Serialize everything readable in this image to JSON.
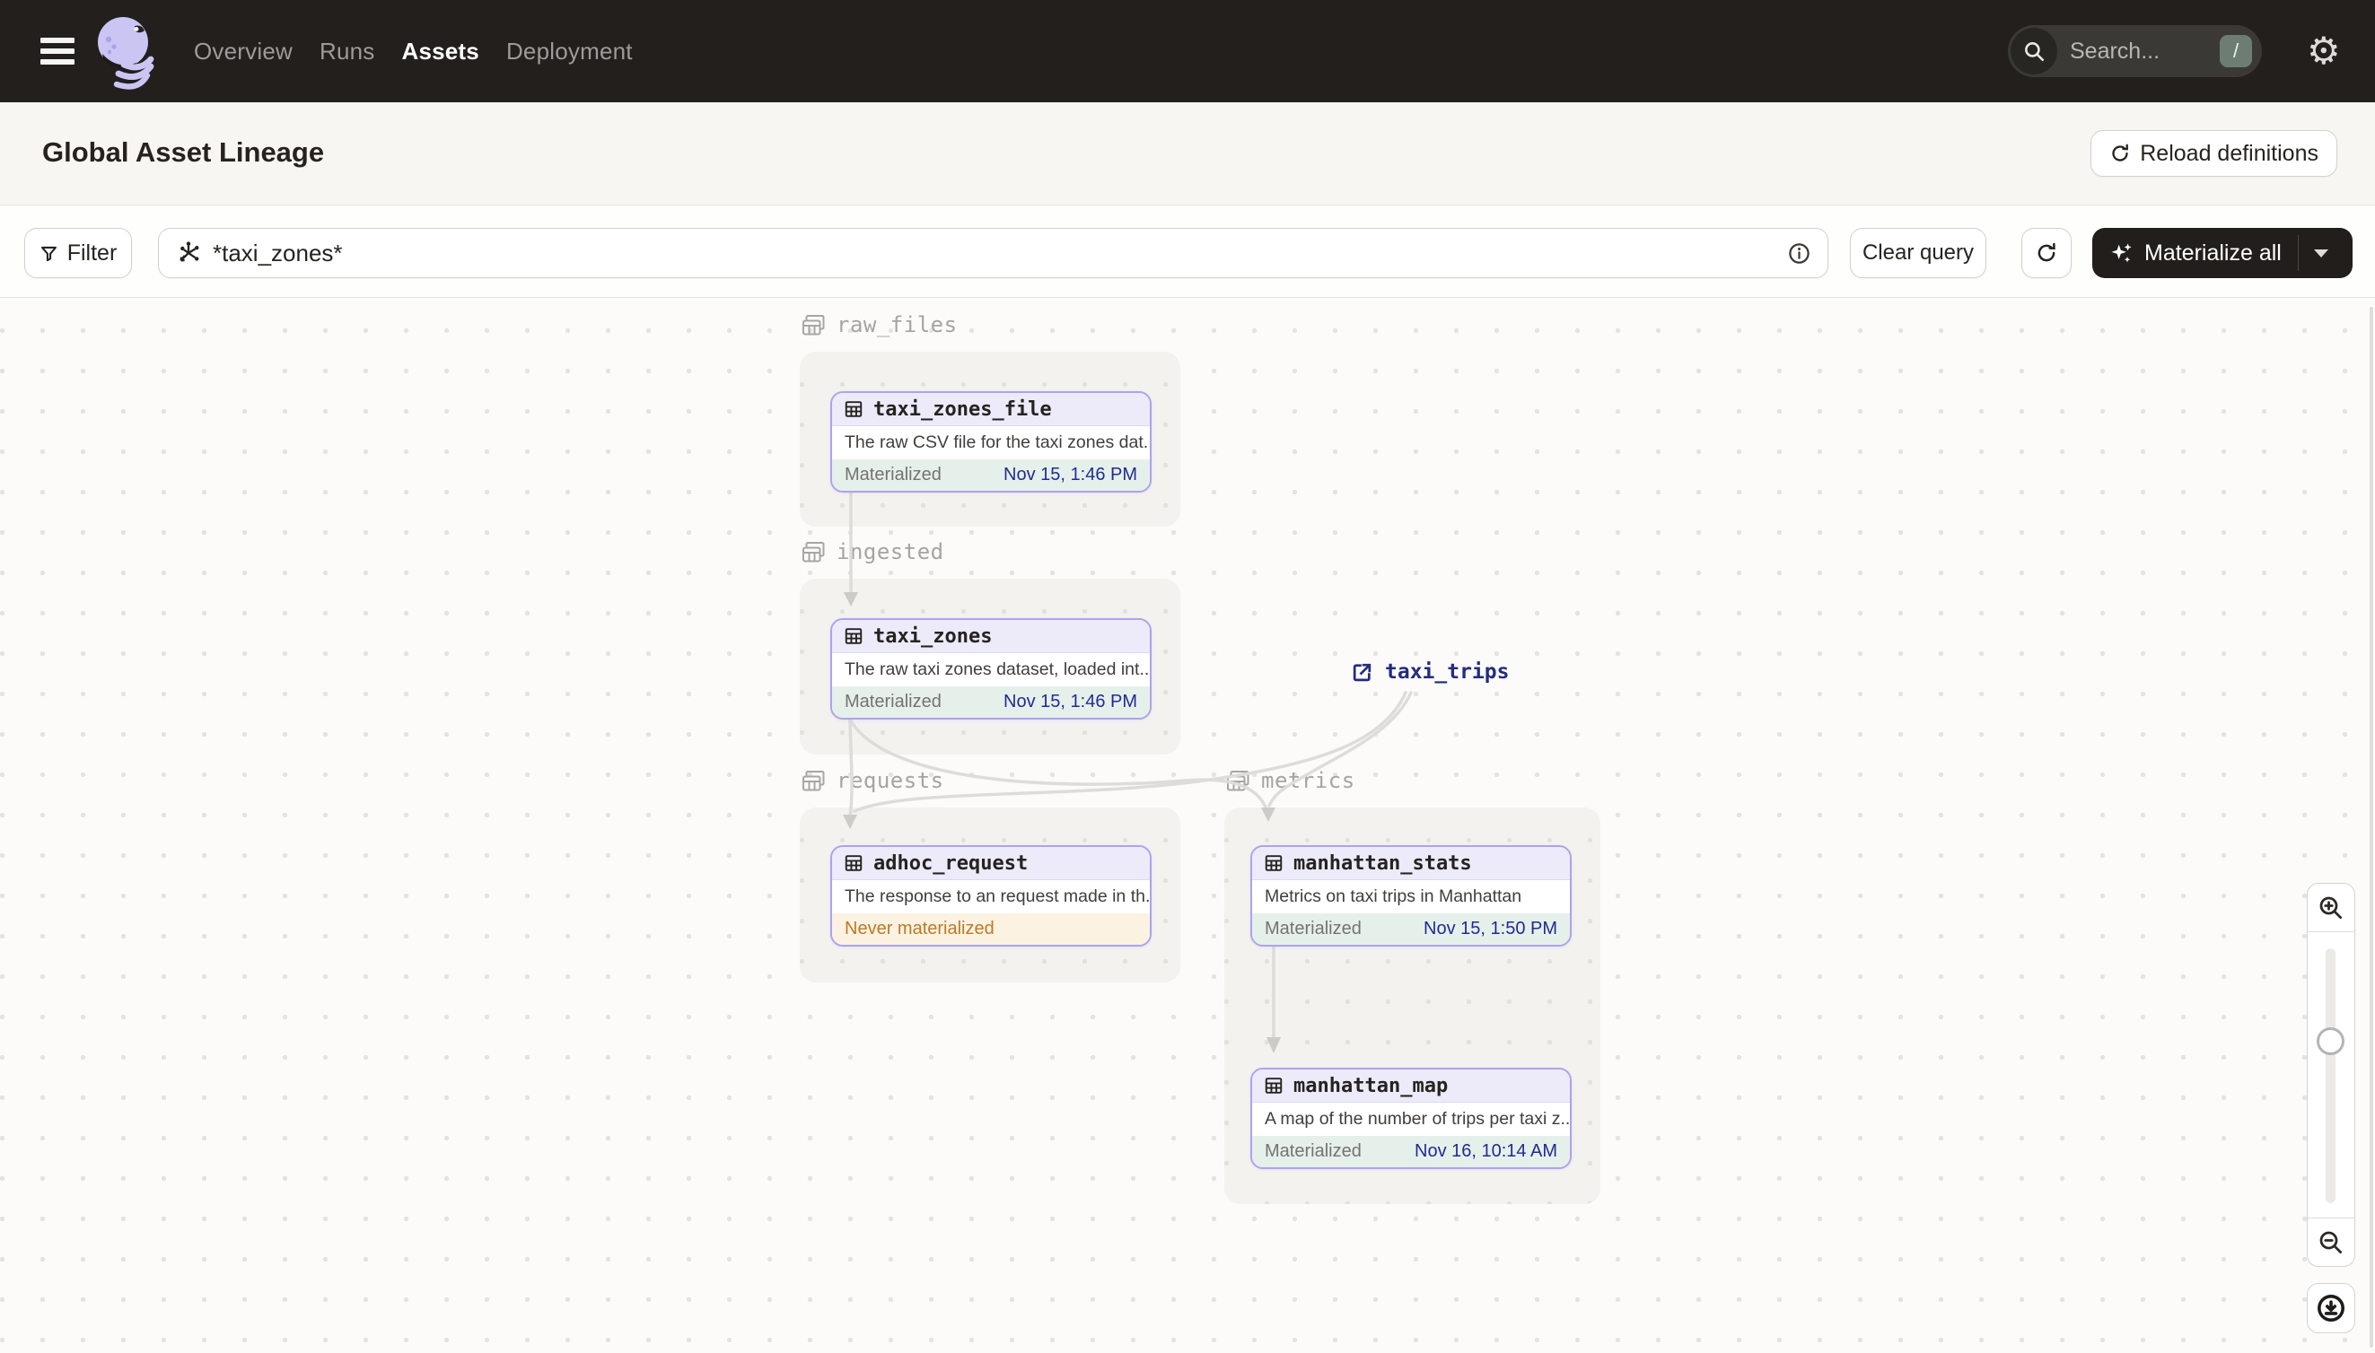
{
  "nav": {
    "items": [
      {
        "label": "Overview",
        "active": false
      },
      {
        "label": "Runs",
        "active": false
      },
      {
        "label": "Assets",
        "active": true
      },
      {
        "label": "Deployment",
        "active": false
      }
    ],
    "search": {
      "placeholder": "Search...",
      "shortcut": "/"
    }
  },
  "header": {
    "title": "Global Asset Lineage",
    "reload_button": "Reload definitions"
  },
  "toolbar": {
    "filter_button": "Filter",
    "query_input": "*taxi_zones*",
    "clear_button": "Clear query",
    "materialize_button": "Materialize all"
  },
  "graph": {
    "groups": [
      {
        "name": "raw_files"
      },
      {
        "name": "ingested"
      },
      {
        "name": "requests"
      },
      {
        "name": "metrics"
      }
    ],
    "nodes": [
      {
        "name": "taxi_zones_file",
        "group": "raw_files",
        "description": "The raw CSV file for the taxi zones dat...",
        "status": "Materialized",
        "timestamp": "Nov 15, 1:46 PM"
      },
      {
        "name": "taxi_zones",
        "group": "ingested",
        "description": "The raw taxi zones dataset, loaded int...",
        "status": "Materialized",
        "timestamp": "Nov 15, 1:46 PM"
      },
      {
        "name": "adhoc_request",
        "group": "requests",
        "description": "The response to an request made in th...",
        "status": "Never materialized",
        "timestamp": ""
      },
      {
        "name": "manhattan_stats",
        "group": "metrics",
        "description": "Metrics on taxi trips in Manhattan",
        "status": "Materialized",
        "timestamp": "Nov 15, 1:50 PM"
      },
      {
        "name": "manhattan_map",
        "group": "metrics",
        "description": "A map of the number of trips per taxi z...",
        "status": "Materialized",
        "timestamp": "Nov 16, 10:14 AM"
      }
    ],
    "external_assets": [
      {
        "name": "taxi_trips"
      }
    ],
    "edges": [
      {
        "from": "taxi_zones_file",
        "to": "taxi_zones"
      },
      {
        "from": "taxi_zones",
        "to": "adhoc_request"
      },
      {
        "from": "taxi_zones",
        "to": "manhattan_stats"
      },
      {
        "from": "taxi_trips",
        "to": "adhoc_request"
      },
      {
        "from": "taxi_trips",
        "to": "manhattan_stats"
      },
      {
        "from": "manhattan_stats",
        "to": "manhattan_map"
      }
    ]
  },
  "colors": {
    "nav_bg": "#221F1D",
    "node_border": "#AEA2ED",
    "node_header_bg": "#EDEAFA",
    "materialized_bg": "#E6F0EA",
    "timestamp_text": "#1F2C94",
    "never_materialized_bg": "#FBF2E2",
    "never_materialized_text": "#BC7A26",
    "external_link_text": "#232C7E",
    "shortcut_badge_bg": "#6E7D73"
  }
}
